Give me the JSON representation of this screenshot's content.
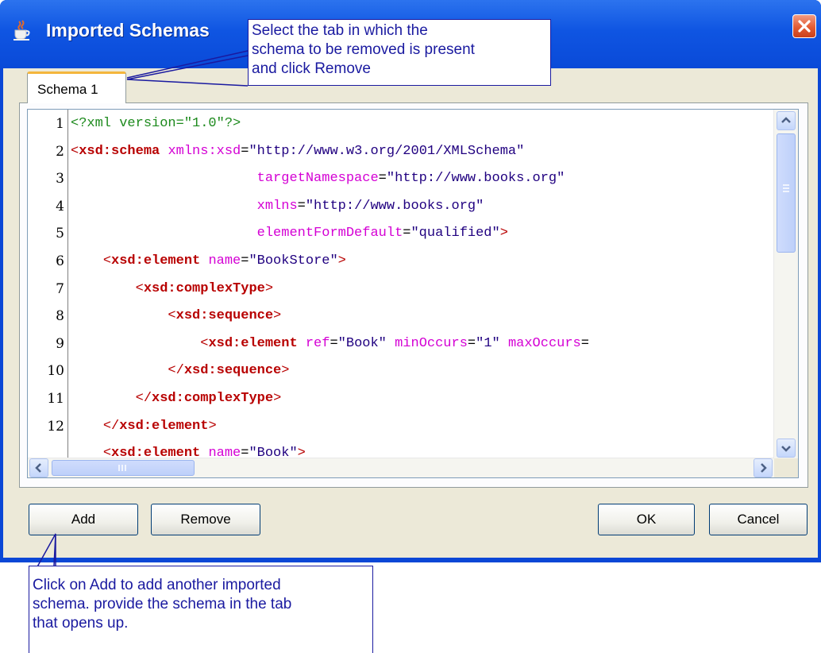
{
  "window": {
    "title": "Imported Schemas",
    "icon": "java-cup-icon",
    "close_icon": "close-icon",
    "accent_color": "#0a47d6"
  },
  "tabs": [
    {
      "label": "Schema 1",
      "selected": true
    }
  ],
  "editor": {
    "line_numbers": [
      "1",
      "2",
      "3",
      "4",
      "5",
      "6",
      "7",
      "8",
      "9",
      "10",
      "11",
      "12"
    ],
    "lines": [
      [
        {
          "t": "pi",
          "v": "<?xml version=\"1.0\"?>"
        }
      ],
      [
        {
          "t": "ang",
          "v": "<"
        },
        {
          "t": "tag",
          "v": "xsd:schema"
        },
        {
          "t": "sp",
          "v": " "
        },
        {
          "t": "atn",
          "v": "xmlns:xsd"
        },
        {
          "t": "eq",
          "v": "="
        },
        {
          "t": "atv",
          "v": "\"http://www.w3.org/2001/XMLSchema\""
        }
      ],
      [
        {
          "t": "sp",
          "v": "                       "
        },
        {
          "t": "atn",
          "v": "targetNamespace"
        },
        {
          "t": "eq",
          "v": "="
        },
        {
          "t": "atv",
          "v": "\"http://www.books.org\""
        }
      ],
      [
        {
          "t": "sp",
          "v": "                       "
        },
        {
          "t": "atn",
          "v": "xmlns"
        },
        {
          "t": "eq",
          "v": "="
        },
        {
          "t": "atv",
          "v": "\"http://www.books.org\""
        }
      ],
      [
        {
          "t": "sp",
          "v": "                       "
        },
        {
          "t": "atn",
          "v": "elementFormDefault"
        },
        {
          "t": "eq",
          "v": "="
        },
        {
          "t": "atv",
          "v": "\"qualified\""
        },
        {
          "t": "ang",
          "v": ">"
        }
      ],
      [
        {
          "t": "sp",
          "v": "    "
        },
        {
          "t": "ang",
          "v": "<"
        },
        {
          "t": "tag",
          "v": "xsd:element"
        },
        {
          "t": "sp",
          "v": " "
        },
        {
          "t": "atn",
          "v": "name"
        },
        {
          "t": "eq",
          "v": "="
        },
        {
          "t": "atv",
          "v": "\"BookStore\""
        },
        {
          "t": "ang",
          "v": ">"
        }
      ],
      [
        {
          "t": "sp",
          "v": "        "
        },
        {
          "t": "ang",
          "v": "<"
        },
        {
          "t": "tag",
          "v": "xsd:complexType"
        },
        {
          "t": "ang",
          "v": ">"
        }
      ],
      [
        {
          "t": "sp",
          "v": "            "
        },
        {
          "t": "ang",
          "v": "<"
        },
        {
          "t": "tag",
          "v": "xsd:sequence"
        },
        {
          "t": "ang",
          "v": ">"
        }
      ],
      [
        {
          "t": "sp",
          "v": "                "
        },
        {
          "t": "ang",
          "v": "<"
        },
        {
          "t": "tag",
          "v": "xsd:element"
        },
        {
          "t": "sp",
          "v": " "
        },
        {
          "t": "atn",
          "v": "ref"
        },
        {
          "t": "eq",
          "v": "="
        },
        {
          "t": "atv",
          "v": "\"Book\""
        },
        {
          "t": "sp",
          "v": " "
        },
        {
          "t": "atn",
          "v": "minOccurs"
        },
        {
          "t": "eq",
          "v": "="
        },
        {
          "t": "atv",
          "v": "\"1\""
        },
        {
          "t": "sp",
          "v": " "
        },
        {
          "t": "atn",
          "v": "maxOccurs"
        },
        {
          "t": "eq",
          "v": "="
        }
      ],
      [
        {
          "t": "sp",
          "v": "            "
        },
        {
          "t": "ang",
          "v": "</"
        },
        {
          "t": "tag",
          "v": "xsd:sequence"
        },
        {
          "t": "ang",
          "v": ">"
        }
      ],
      [
        {
          "t": "sp",
          "v": "        "
        },
        {
          "t": "ang",
          "v": "</"
        },
        {
          "t": "tag",
          "v": "xsd:complexType"
        },
        {
          "t": "ang",
          "v": ">"
        }
      ],
      [
        {
          "t": "sp",
          "v": "    "
        },
        {
          "t": "ang",
          "v": "</"
        },
        {
          "t": "tag",
          "v": "xsd:element"
        },
        {
          "t": "ang",
          "v": ">"
        }
      ],
      [
        {
          "t": "sp",
          "v": "    "
        },
        {
          "t": "ang",
          "v": "<"
        },
        {
          "t": "tag",
          "v": "xsd:element"
        },
        {
          "t": "sp",
          "v": " "
        },
        {
          "t": "atn",
          "v": "name"
        },
        {
          "t": "eq",
          "v": "="
        },
        {
          "t": "atv",
          "v": "\"Book\""
        },
        {
          "t": "ang",
          "v": ">"
        }
      ]
    ],
    "syntax_colors": {
      "processing_instruction": "#1d8a1d",
      "tag": "#b80000",
      "attribute_name": "#d400d4",
      "attribute_value": "#200080"
    }
  },
  "scrollbars": {
    "up_icon": "scroll-up-icon",
    "down_icon": "scroll-down-icon",
    "left_icon": "scroll-left-icon",
    "right_icon": "scroll-right-icon"
  },
  "buttons": {
    "add": "Add",
    "remove": "Remove",
    "ok": "OK",
    "cancel": "Cancel"
  },
  "callouts": {
    "tab_hint": [
      "Select the tab in which the",
      "schema to be removed is present",
      "and click Remove"
    ],
    "add_hint": [
      "Click on Add to add another imported",
      "schema. provide the schema in the tab",
      "that opens up."
    ]
  }
}
